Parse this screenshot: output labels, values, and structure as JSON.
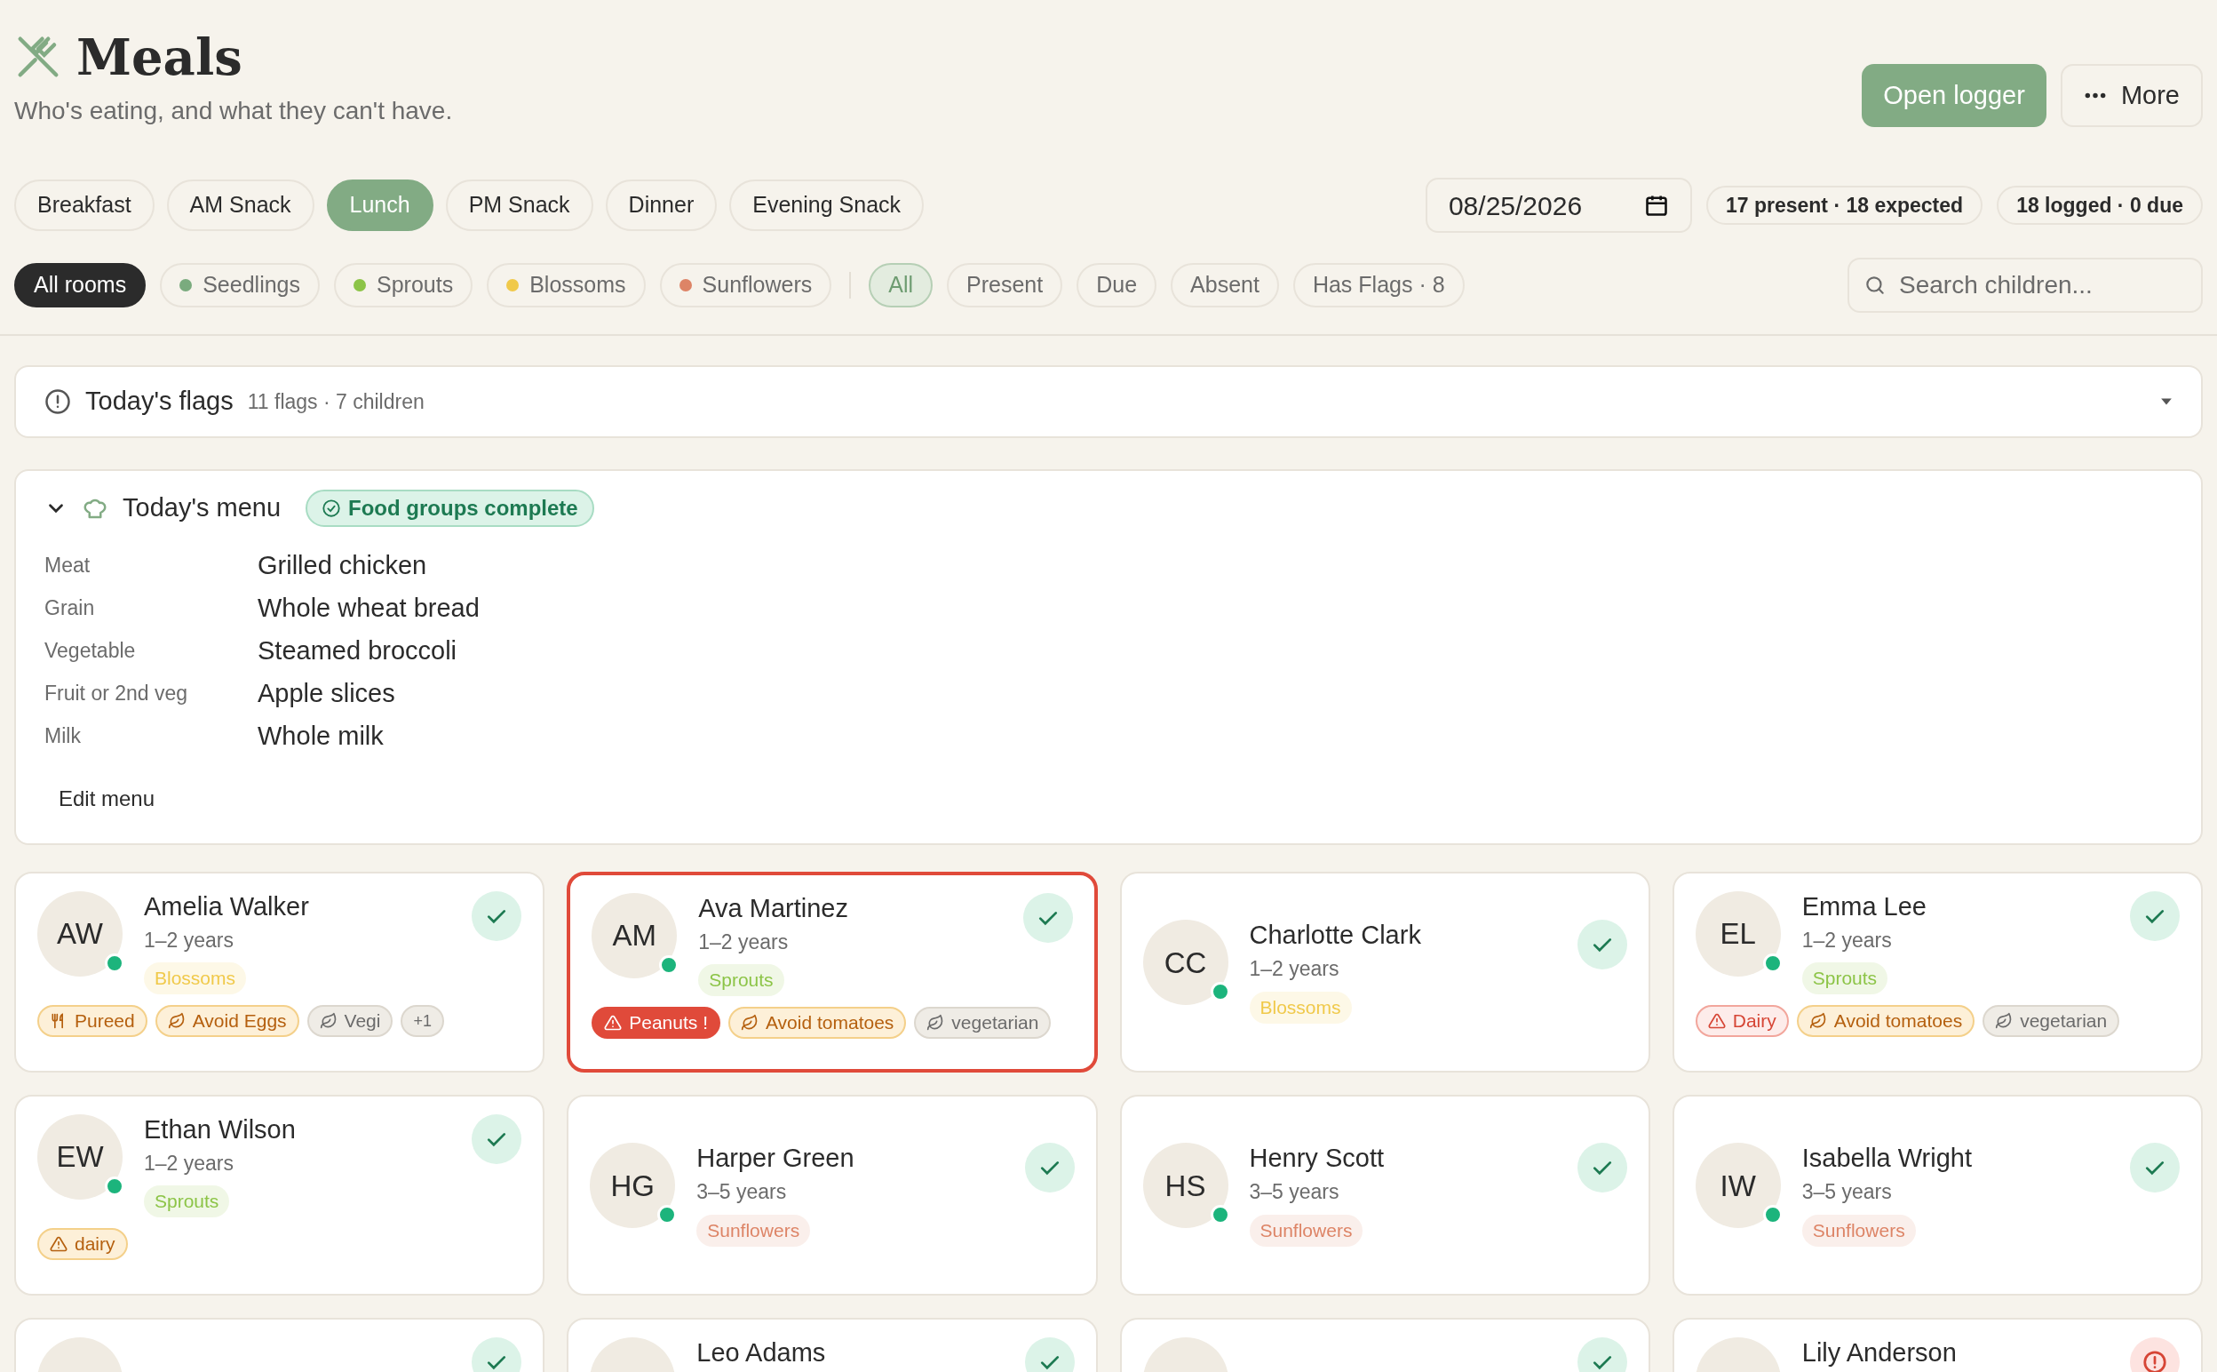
{
  "header": {
    "title": "Meals",
    "subtitle": "Who's eating, and what they can't have.",
    "primary_button": "Open logger",
    "more_button": "More"
  },
  "meal_tabs": [
    {
      "label": "Breakfast",
      "selected": false
    },
    {
      "label": "AM Snack",
      "selected": false
    },
    {
      "label": "Lunch",
      "selected": true
    },
    {
      "label": "PM Snack",
      "selected": false
    },
    {
      "label": "Dinner",
      "selected": false
    },
    {
      "label": "Evening Snack",
      "selected": false
    }
  ],
  "date": "08/25/2026",
  "stats": [
    "17 present · 18 expected",
    "18 logged · 0 due"
  ],
  "rooms": [
    {
      "label": "All rooms",
      "selected": true
    },
    {
      "label": "Seedlings",
      "selected": false,
      "color": "#7aab7e"
    },
    {
      "label": "Sprouts",
      "selected": false,
      "color": "#8cc447"
    },
    {
      "label": "Blossoms",
      "selected": false,
      "color": "#f0c94a"
    },
    {
      "label": "Sunflowers",
      "selected": false,
      "color": "#dd8466"
    }
  ],
  "status_filters": [
    {
      "label": "All",
      "selected": true
    },
    {
      "label": "Present",
      "selected": false
    },
    {
      "label": "Due",
      "selected": false
    },
    {
      "label": "Absent",
      "selected": false
    },
    {
      "label": "Has Flags · 8",
      "selected": false
    }
  ],
  "search": {
    "placeholder": "Search children..."
  },
  "flags_panel": {
    "title": "Today's flags",
    "summary": "11 flags · 7 children",
    "expanded": false
  },
  "menu": {
    "title": "Today's menu",
    "expanded": true,
    "badge": "Food groups complete",
    "items": [
      {
        "group": "Meat",
        "food": "Grilled chicken"
      },
      {
        "group": "Grain",
        "food": "Whole wheat bread"
      },
      {
        "group": "Vegetable",
        "food": "Steamed broccoli"
      },
      {
        "group": "Fruit or 2nd veg",
        "food": "Apple slices"
      },
      {
        "group": "Milk",
        "food": "Whole milk"
      }
    ],
    "edit_button": "Edit menu"
  },
  "children": [
    {
      "kind": "logged",
      "initials": "AW",
      "name": "Amelia Walker",
      "age": "1–2 years",
      "room": {
        "label": "Blossoms",
        "color": "#f0c94a"
      },
      "present": true,
      "alert": false,
      "tags": [
        {
          "label": "Pureed",
          "kind": "texture"
        },
        {
          "label": "Avoid Eggs",
          "kind": "avoid"
        },
        {
          "label": "Vegi",
          "kind": "diet"
        },
        {
          "label": "+1",
          "kind": "more"
        }
      ]
    },
    {
      "kind": "logged",
      "initials": "AM",
      "name": "Ava Martinez",
      "age": "1–2 years",
      "room": {
        "label": "Sprouts",
        "color": "#8cc447"
      },
      "present": true,
      "alert": true,
      "tags": [
        {
          "label": "Peanuts !",
          "kind": "severe"
        },
        {
          "label": "Avoid tomatoes",
          "kind": "avoid"
        },
        {
          "label": "vegetarian",
          "kind": "diet"
        }
      ]
    },
    {
      "kind": "logged",
      "initials": "CC",
      "name": "Charlotte Clark",
      "age": "1–2 years",
      "room": {
        "label": "Blossoms",
        "color": "#f0c94a"
      },
      "present": true,
      "alert": false
    },
    {
      "kind": "logged",
      "initials": "EL",
      "name": "Emma Lee",
      "age": "1–2 years",
      "room": {
        "label": "Sprouts",
        "color": "#8cc447"
      },
      "present": true,
      "alert": false,
      "tags": [
        {
          "label": "Dairy",
          "kind": "allergy"
        },
        {
          "label": "Avoid tomatoes",
          "kind": "avoid"
        },
        {
          "label": "vegetarian",
          "kind": "diet"
        }
      ]
    },
    {
      "kind": "logged",
      "initials": "EW",
      "name": "Ethan Wilson",
      "age": "1–2 years",
      "room": {
        "label": "Sprouts",
        "color": "#8cc447"
      },
      "present": true,
      "alert": false,
      "tags": [
        {
          "label": "dairy",
          "kind": "sensitivity"
        }
      ]
    },
    {
      "kind": "logged",
      "initials": "HG",
      "name": "Harper Green",
      "age": "3–5 years",
      "room": {
        "label": "Sunflowers",
        "color": "#dd8466"
      },
      "present": true,
      "alert": false
    },
    {
      "kind": "logged",
      "initials": "HS",
      "name": "Henry Scott",
      "age": "3–5 years",
      "room": {
        "label": "Sunflowers",
        "color": "#dd8466"
      },
      "present": true,
      "alert": false
    },
    {
      "kind": "logged",
      "initials": "IW",
      "name": "Isabella Wright",
      "age": "3–5 years",
      "room": {
        "label": "Sunflowers",
        "color": "#dd8466"
      },
      "present": true,
      "alert": false
    },
    {
      "kind": "logged",
      "alert": false
    },
    {
      "kind": "logged",
      "name": "Leo Adams",
      "alert": false
    },
    {
      "kind": "logged",
      "alert": false
    },
    {
      "kind": "flagged",
      "name": "Lily Anderson",
      "alert": false
    }
  ]
}
